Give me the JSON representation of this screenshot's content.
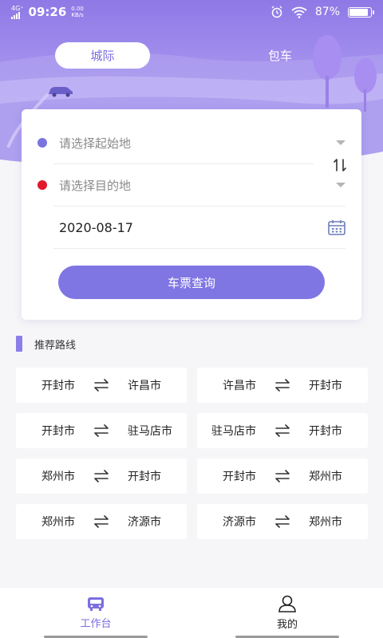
{
  "status_bar": {
    "network": "4G⁺",
    "time": "09:26",
    "speed_value": "0.00",
    "speed_unit": "KB/s",
    "battery": "87%",
    "battery_level": 0.87
  },
  "tabs": [
    {
      "label": "城际",
      "selected": true
    },
    {
      "label": "包车",
      "selected": false
    }
  ],
  "search": {
    "origin_placeholder": "请选择起始地",
    "destination_placeholder": "请选择目的地",
    "date": "2020-08-17",
    "query_button": "车票查询",
    "origin_dot_color": "#7a74e0",
    "destination_dot_color": "#e0192c"
  },
  "recommended": {
    "title": "推荐路线",
    "routes": [
      {
        "from": "开封市",
        "to": "许昌市"
      },
      {
        "from": "许昌市",
        "to": "开封市"
      },
      {
        "from": "开封市",
        "to": "驻马店市"
      },
      {
        "from": "驻马店市",
        "to": "开封市"
      },
      {
        "from": "郑州市",
        "to": "开封市"
      },
      {
        "from": "开封市",
        "to": "郑州市"
      },
      {
        "from": "郑州市",
        "to": "济源市"
      },
      {
        "from": "济源市",
        "to": "郑州市"
      }
    ]
  },
  "bottom_nav": [
    {
      "label": "工作台",
      "icon": "bus-icon",
      "active": true,
      "color": "#7b6ee0"
    },
    {
      "label": "我的",
      "icon": "person-icon",
      "active": false,
      "color": "#222222"
    }
  ],
  "colors": {
    "accent": "#7f76e4",
    "hero_top": "#8e79e6"
  }
}
